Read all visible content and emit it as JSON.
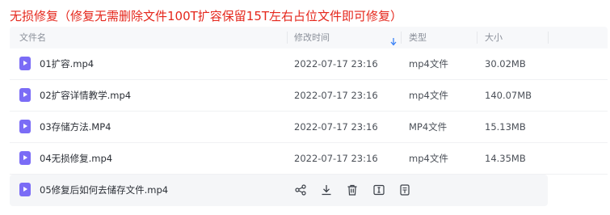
{
  "heading": "无损修复（修复无需删除文件100T扩容保留15T左右占位文件即可修复）",
  "columns": {
    "name": "文件名",
    "modified": "修改时间",
    "type": "类型",
    "size": "大小"
  },
  "colors": {
    "heading": "#e5271c",
    "file_icon": "#7b6cf6",
    "sort_icon": "#3b82f6"
  },
  "files": [
    {
      "name": "01扩容.mp4",
      "modified": "2022-07-17 23:16",
      "type": "mp4文件",
      "size": "30.02MB"
    },
    {
      "name": "02扩容详情教学.mp4",
      "modified": "2022-07-17 23:16",
      "type": "mp4文件",
      "size": "140.07MB"
    },
    {
      "name": "03存储方法.MP4",
      "modified": "2022-07-17 23:16",
      "type": "MP4文件",
      "size": "15.13MB"
    },
    {
      "name": "04无损修复.mp4",
      "modified": "2022-07-17 23:16",
      "type": "mp4文件",
      "size": "14.35MB"
    },
    {
      "name": "05修复后如何去储存文件.mp4",
      "hovered": true
    }
  ],
  "row_actions": [
    "share-icon",
    "download-icon",
    "delete-icon",
    "rename-icon",
    "more-icon"
  ]
}
